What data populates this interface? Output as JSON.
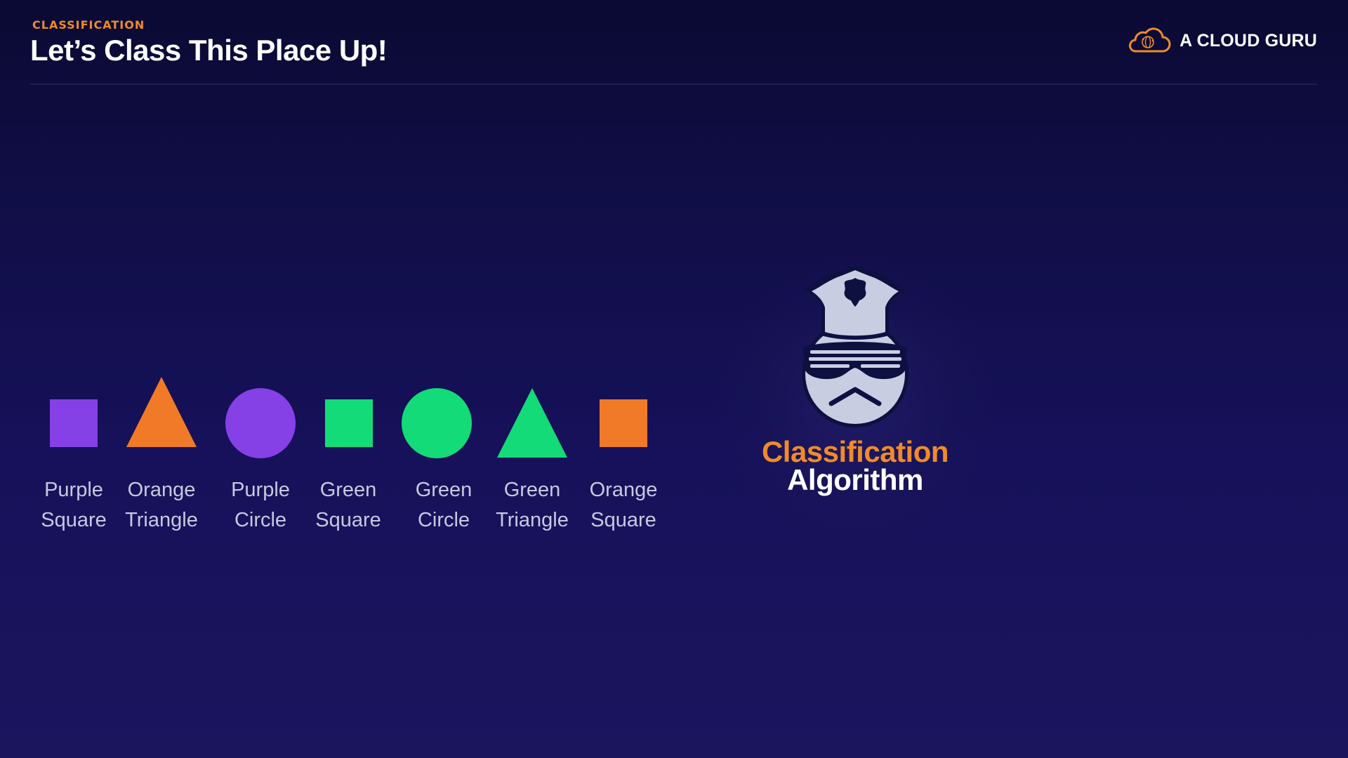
{
  "header": {
    "eyebrow": "CLASSIFICATION",
    "title": "Let’s Class This Place Up!"
  },
  "brand": {
    "name": "A CLOUD GURU",
    "icon": "cloud-logo-icon"
  },
  "colors": {
    "accent_orange": "#f08a2a",
    "purple": "#8540e6",
    "orange": "#f07a28",
    "green": "#13db78",
    "background": "#110e48",
    "text_light": "#c8c8e0"
  },
  "shapes": [
    {
      "line1": "Purple",
      "line2": "Square",
      "icon": "purple-square"
    },
    {
      "line1": "Orange",
      "line2": "Triangle",
      "icon": "orange-triangle"
    },
    {
      "line1": "Purple",
      "line2": "Circle",
      "icon": "purple-circle"
    },
    {
      "line1": "Green",
      "line2": "Square",
      "icon": "green-square"
    },
    {
      "line1": "Green",
      "line2": "Circle",
      "icon": "green-circle"
    },
    {
      "line1": "Green",
      "line2": "Triangle",
      "icon": "green-triangle"
    },
    {
      "line1": "Orange",
      "line2": "Square",
      "icon": "orange-square"
    }
  ],
  "algorithm": {
    "line1": "Classification",
    "line2": "Algorithm",
    "icon": "police-officer-icon"
  }
}
